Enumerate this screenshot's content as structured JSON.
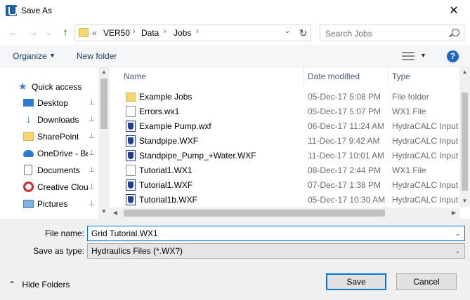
{
  "window": {
    "title": "Save As",
    "close_glyph": "✕"
  },
  "nav": {
    "back_glyph": "←",
    "forward_glyph": "→",
    "recent_glyph": "⌄",
    "up_glyph": "↑"
  },
  "address": {
    "overflow": "«",
    "segments": [
      "VER50",
      "Data",
      "Jobs"
    ],
    "separator": "›",
    "dropdown_glyph": "⌄",
    "refresh_glyph": "↻"
  },
  "search": {
    "placeholder": "Search Jobs"
  },
  "toolbar": {
    "organize_label": "Organize",
    "organize_caret": "▼",
    "new_folder_label": "New folder",
    "view_caret": "▼",
    "help_glyph": "?"
  },
  "sidebar": {
    "items": [
      {
        "label": "Quick access",
        "icon": "star-icon",
        "pinned": false
      },
      {
        "label": "Desktop",
        "icon": "desktop-icon",
        "pinned": true
      },
      {
        "label": "Downloads",
        "icon": "download-icon",
        "pinned": true
      },
      {
        "label": "SharePoint",
        "icon": "folder-icon",
        "pinned": true
      },
      {
        "label": "OneDrive - Be",
        "icon": "onedrive-icon",
        "pinned": true
      },
      {
        "label": "Documents",
        "icon": "documents-icon",
        "pinned": true
      },
      {
        "label": "Creative Clou",
        "icon": "creative-cloud-icon",
        "pinned": true
      },
      {
        "label": "Pictures",
        "icon": "pictures-icon",
        "pinned": true
      }
    ],
    "pin_glyph": "📌",
    "scroll_up_glyph": "▲",
    "scroll_down_glyph": "▼"
  },
  "columns": {
    "name": "Name",
    "date": "Date modified",
    "type": "Type",
    "sort_glyph": "^"
  },
  "files": [
    {
      "name": "Example Jobs",
      "date": "05-Dec-17 5:08 PM",
      "type": "File folder",
      "icon": "folder-icon"
    },
    {
      "name": "Errors.wx1",
      "date": "05-Dec-17 5:07 PM",
      "type": "WX1 File",
      "icon": "document-icon"
    },
    {
      "name": "Example Pump.wxf",
      "date": "06-Dec-17 11:24 AM",
      "type": "HydraCALC Input",
      "icon": "hydracalc-file-icon"
    },
    {
      "name": "Standpipe.WXF",
      "date": "11-Dec-17 9:42 AM",
      "type": "HydraCALC Input",
      "icon": "hydracalc-file-icon"
    },
    {
      "name": "Standpipe_Pump_+Water.WXF",
      "date": "11-Dec-17 10:01 AM",
      "type": "HydraCALC Input",
      "icon": "hydracalc-file-icon"
    },
    {
      "name": "Tutorial1.WX1",
      "date": "08-Dec-17 2:44 PM",
      "type": "WX1 File",
      "icon": "document-icon"
    },
    {
      "name": "Tutorial1.WXF",
      "date": "07-Dec-17 1:38 PM",
      "type": "HydraCALC Input",
      "icon": "hydracalc-file-icon"
    },
    {
      "name": "Tutorial1b.WXF",
      "date": "05-Dec-17 10:30 AM",
      "type": "HydraCALC Input",
      "icon": "hydracalc-file-icon"
    }
  ],
  "filelist_scroll": {
    "up_glyph": "▲",
    "down_glyph": "▼",
    "left_glyph": "◀",
    "right_glyph": "▶"
  },
  "form": {
    "file_name_label": "File name:",
    "file_name_value": "Grid Tutorial.WX1",
    "save_type_label": "Save as type:",
    "save_type_value": "Hydraulics Files (*.WX?)",
    "dropdown_glyph": "⌄"
  },
  "footer": {
    "hide_folders_glyph": "⌃",
    "hide_folders_label": "Hide Folders",
    "save_label": "Save",
    "cancel_label": "Cancel"
  }
}
